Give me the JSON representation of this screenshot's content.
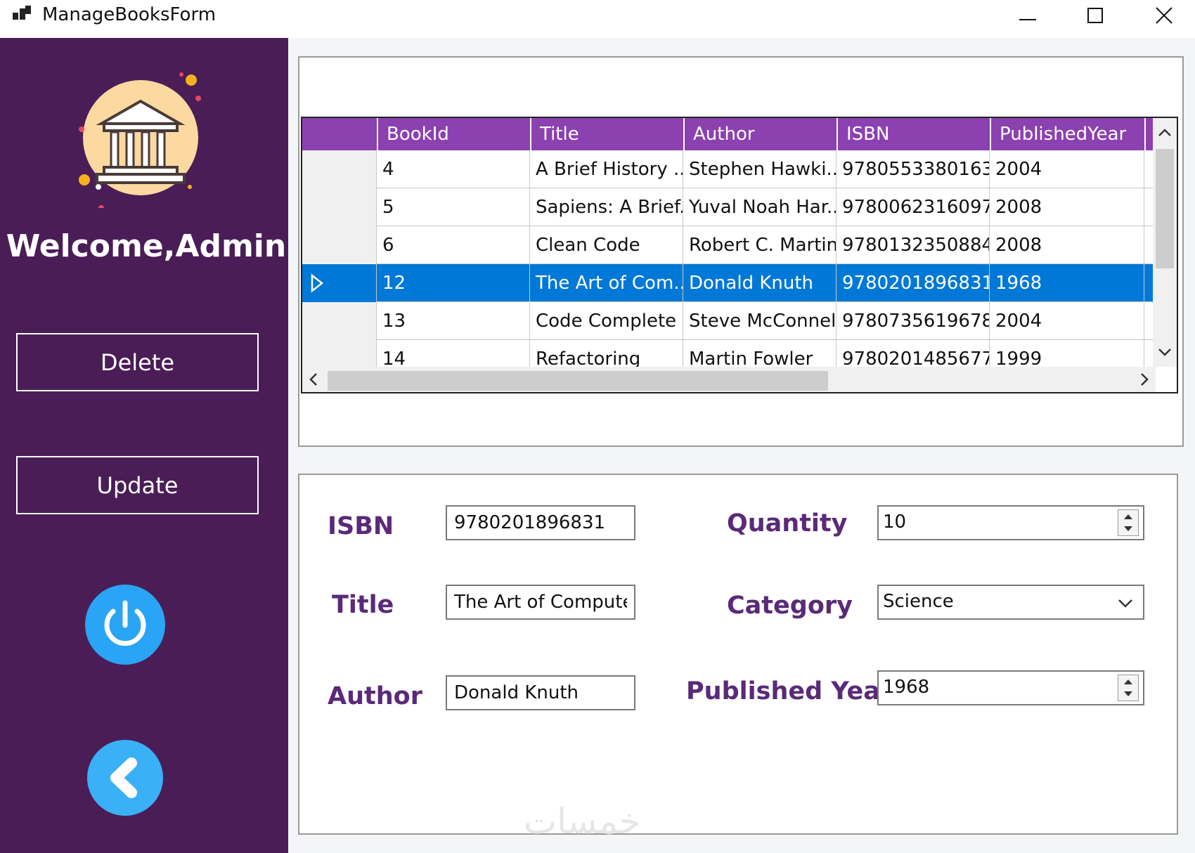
{
  "window": {
    "title": "ManageBooksForm"
  },
  "sidebar": {
    "welcome": "Welcome,Admin",
    "delete_label": "Delete",
    "update_label": "Update",
    "power_icon": "power-icon",
    "back_icon": "back-arrow-icon",
    "bg_color": "#4a1d57",
    "round_button_color": "#2aa4f4"
  },
  "grid": {
    "columns": [
      "BookId",
      "Title",
      "Author",
      "ISBN",
      "PublishedYear"
    ],
    "rows": [
      {
        "id": "4",
        "title": "A Brief History ...",
        "author": "Stephen Hawki...",
        "isbn": "9780553380163",
        "year": "2004"
      },
      {
        "id": "5",
        "title": "Sapiens: A Brief...",
        "author": "Yuval Noah Har...",
        "isbn": "9780062316097",
        "year": "2008"
      },
      {
        "id": "6",
        "title": "Clean Code",
        "author": "Robert C. Martin",
        "isbn": "9780132350884",
        "year": "2008"
      },
      {
        "id": "12",
        "title": "The Art of Com...",
        "author": "Donald Knuth",
        "isbn": "9780201896831",
        "year": "1968",
        "selected": true
      },
      {
        "id": "13",
        "title": "Code Complete",
        "author": "Steve McConnell",
        "isbn": "9780735619678",
        "year": "2004"
      },
      {
        "id": "14",
        "title": "Refactoring",
        "author": "Martin Fowler",
        "isbn": "9780201485677",
        "year": "1999"
      }
    ],
    "header_color": "#8c41b0",
    "selected_color": "#0078d7"
  },
  "form": {
    "isbn_label": "ISBN",
    "isbn_value": "9780201896831",
    "title_label": "Title",
    "title_value": "The Art of Computer",
    "author_label": "Author",
    "author_value": "Donald Knuth",
    "quantity_label": "Quantity",
    "quantity_value": "10",
    "category_label": "Category",
    "category_value": "Science",
    "year_label": "Published Year",
    "year_value": "1968",
    "label_color": "#5a2a78"
  },
  "watermark": "خمسات"
}
